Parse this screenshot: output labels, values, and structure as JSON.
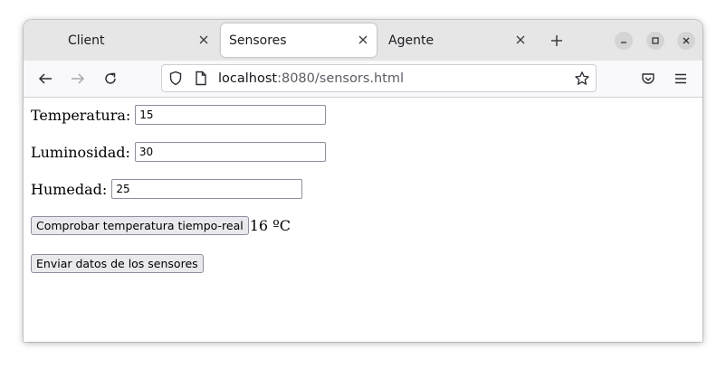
{
  "browser": {
    "tabs": [
      {
        "label": "Client",
        "active": false
      },
      {
        "label": "Sensores",
        "active": true
      },
      {
        "label": "Agente",
        "active": false
      }
    ],
    "url": {
      "host": "localhost",
      "rest": ":8080/sensors.html"
    }
  },
  "form": {
    "temperature_label": "Temperatura:",
    "temperature_value": "15",
    "luminosity_label": "Luminosidad:",
    "luminosity_value": "30",
    "humidity_label": "Humedad:",
    "humidity_value": "25",
    "check_button": "Comprobar temperatura tiempo-real",
    "realtime_temperature": "16 ºC",
    "send_button": "Enviar datos de los sensores"
  },
  "icons": [
    "close-icon",
    "plus-icon",
    "minimize-icon",
    "maximize-icon",
    "back-icon",
    "forward-icon",
    "reload-icon",
    "shield-icon",
    "page-icon",
    "star-icon",
    "pocket-icon",
    "menu-icon"
  ],
  "colors": {
    "tabstrip": "#e6e6e6",
    "toolbar": "#f9f9fb",
    "button": "#e9e9ed"
  }
}
